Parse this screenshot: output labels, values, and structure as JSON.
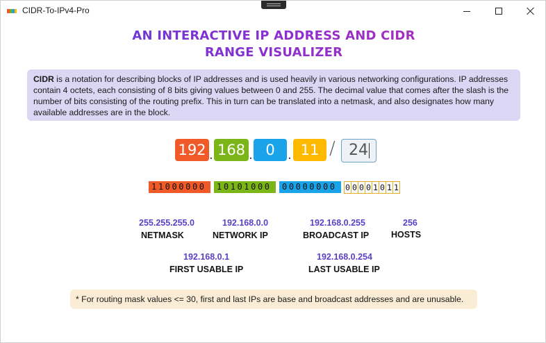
{
  "window": {
    "title": "CIDR-To-IPv4-Pro",
    "icon_colors": [
      "#f05a28",
      "#7cb518",
      "#1aa3e8",
      "#ffb900"
    ]
  },
  "heading": {
    "line1": "AN INTERACTIVE IP ADDRESS AND CIDR",
    "line2": "RANGE VISUALIZER"
  },
  "description": {
    "term": "CIDR",
    "text": " is a notation for describing blocks of IP addresses and is used heavily in various networking configurations. IP addresses contain 4 octets, each consisting of 8 bits giving values between 0 and 255. The decimal value that comes after the slash is the number of bits consisting of the routing prefix. This in turn can be translated into a netmask, and also designates how many available addresses are in the block."
  },
  "ip": {
    "octets": [
      {
        "value": "192",
        "color": "#f05a28"
      },
      {
        "value": "168",
        "color": "#7cb518"
      },
      {
        "value": "0",
        "color": "#1aa3e8"
      },
      {
        "value": "11",
        "color": "#ffb900"
      }
    ],
    "dot": ".",
    "slash": "/",
    "prefix": "24"
  },
  "binary": {
    "blocks": [
      {
        "bits": "11000000",
        "color": "#f05a28"
      },
      {
        "bits": "10101000",
        "color": "#7cb518"
      },
      {
        "bits": "00000000",
        "color": "#1aa3e8"
      }
    ],
    "host_bits": [
      "0",
      "0",
      "0",
      "0",
      "1",
      "0",
      "1",
      "1"
    ],
    "host_border_color": "#e3b023"
  },
  "results": {
    "netmask": {
      "value": "255.255.255.0",
      "label": "NETMASK"
    },
    "network_ip": {
      "value": "192.168.0.0",
      "label": "NETWORK  IP"
    },
    "broadcast_ip": {
      "value": "192.168.0.255",
      "label": "BROADCAST IP"
    },
    "hosts": {
      "value": "256",
      "label": "HOSTS"
    },
    "first_usable": {
      "value": "192.168.0.1",
      "label": "FIRST USABLE IP"
    },
    "last_usable": {
      "value": "192.168.0.254",
      "label": "LAST USABLE IP"
    }
  },
  "note": "* For routing mask values <= 30, first and last IPs are base and broadcast addresses and are unusable."
}
